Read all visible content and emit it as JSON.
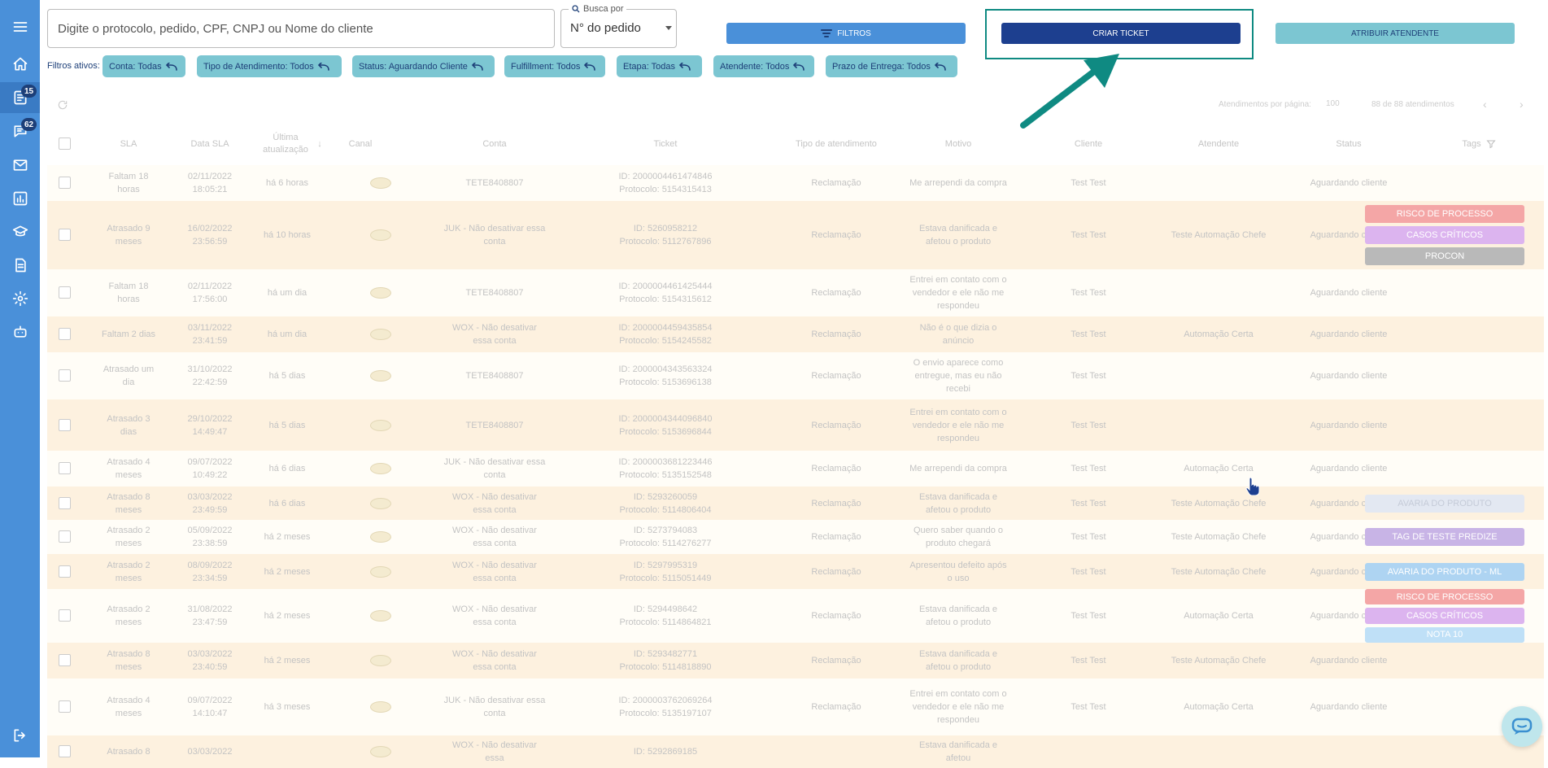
{
  "sidebar": {
    "items": [
      {
        "name": "menu-icon",
        "badge": ""
      },
      {
        "name": "home-icon",
        "badge": ""
      },
      {
        "name": "tickets-icon",
        "badge": "15"
      },
      {
        "name": "chat-icon",
        "badge": "62"
      },
      {
        "name": "mail-icon",
        "badge": ""
      },
      {
        "name": "reports-icon",
        "badge": ""
      },
      {
        "name": "training-icon",
        "badge": ""
      },
      {
        "name": "document-icon",
        "badge": ""
      },
      {
        "name": "settings-icon",
        "badge": ""
      },
      {
        "name": "bot-icon",
        "badge": ""
      },
      {
        "name": "logout-icon",
        "badge": ""
      }
    ]
  },
  "search": {
    "placeholder": "Digite o protocolo, pedido, CPF, CNPJ ou Nome do cliente",
    "busca_label": "Busca por",
    "busca_value": "N° do pedido"
  },
  "buttons": {
    "filtros": "FILTROS",
    "criar_ticket": "CRIAR TICKET",
    "atribuir_atendente": "ATRIBUIR ATENDENTE"
  },
  "filters": {
    "label": "Filtros ativos:",
    "chips": [
      "Conta: Todas",
      "Tipo de Atendimento: Todos",
      "Status:  Aguardando Cliente",
      "Fulfillment: Todos",
      "Etapa: Todas",
      "Atendente: Todos",
      "Prazo de Entrega: Todos"
    ]
  },
  "table": {
    "per_page_label": "Atendimentos por página:",
    "per_page_value": "100",
    "range_label": "88 de 88 atendimentos",
    "headers": {
      "sla": "SLA",
      "data_sla": "Data SLA",
      "ultima": "Última atualização",
      "canal": "Canal",
      "conta": "Conta",
      "ticket": "Ticket",
      "tipo": "Tipo de atendimento",
      "motivo": "Motivo",
      "cliente": "Cliente",
      "atendente": "Atendente",
      "status": "Status",
      "tags": "Tags"
    },
    "rows": [
      {
        "sla": "Faltam 18 horas",
        "data_sla": "02/11/2022 18:05:21",
        "ultima": "há 6 horas",
        "conta": "TETE8408807",
        "ticket_id": "ID: 2000004461474846",
        "protocolo": "Protocolo: 5154315413",
        "tipo": "Reclamação",
        "motivo": "Me arrependi da compra",
        "cliente": "Test Test",
        "atendente": "",
        "status": "Aguardando cliente",
        "tags": []
      },
      {
        "sla": "Atrasado 9 meses",
        "data_sla": "16/02/2022 23:56:59",
        "ultima": "há 10 horas",
        "conta": "JUK - Não desativar essa conta",
        "ticket_id": "ID: 5260958212",
        "protocolo": "Protocolo: 5112767896",
        "tipo": "Reclamação",
        "motivo": "Estava danificada e afetou o produto",
        "cliente": "Test Test",
        "atendente": "Teste Automação Chefe",
        "status": "Aguardando cliente",
        "tags": [
          {
            "label": "RISCO DE PROCESSO",
            "color": "#f4a6a6"
          },
          {
            "label": "CASOS CRÍTICOS",
            "color": "#dcb4ef"
          },
          {
            "label": "PROCON",
            "color": "#b9b9b9"
          }
        ]
      },
      {
        "sla": "Faltam 18 horas",
        "data_sla": "02/11/2022 17:56:00",
        "ultima": "há um dia",
        "conta": "TETE8408807",
        "ticket_id": "ID: 2000004461425444",
        "protocolo": "Protocolo: 5154315612",
        "tipo": "Reclamação",
        "motivo": "Entrei em contato com o vendedor e ele não me respondeu",
        "cliente": "Test Test",
        "atendente": "",
        "status": "Aguardando cliente",
        "tags": []
      },
      {
        "sla": "Faltam 2 dias",
        "data_sla": "03/11/2022 23:41:59",
        "ultima": "há um dia",
        "conta": "WOX - Não desativar essa conta",
        "ticket_id": "ID: 2000004459435854",
        "protocolo": "Protocolo: 5154245582",
        "tipo": "Reclamação",
        "motivo": "Não é o que dizia o anúncio",
        "cliente": "Test Test",
        "atendente": "Automação Certa",
        "status": "Aguardando cliente",
        "tags": []
      },
      {
        "sla": "Atrasado um dia",
        "data_sla": "31/10/2022 22:42:59",
        "ultima": "há 5 dias",
        "conta": "TETE8408807",
        "ticket_id": "ID: 2000004343563324",
        "protocolo": "Protocolo: 5153696138",
        "tipo": "Reclamação",
        "motivo": "O envio aparece como entregue, mas eu não recebi",
        "cliente": "Test Test",
        "atendente": "",
        "status": "Aguardando cliente",
        "tags": []
      },
      {
        "sla": "Atrasado 3 dias",
        "data_sla": "29/10/2022 14:49:47",
        "ultima": "há 5 dias",
        "conta": "TETE8408807",
        "ticket_id": "ID: 2000004344096840",
        "protocolo": "Protocolo: 5153696844",
        "tipo": "Reclamação",
        "motivo": "Entrei em contato com o vendedor e ele não me respondeu",
        "cliente": "Test Test",
        "atendente": "",
        "status": "Aguardando cliente",
        "tags": []
      },
      {
        "sla": "Atrasado 4 meses",
        "data_sla": "09/07/2022 10:49:22",
        "ultima": "há 6 dias",
        "conta": "JUK - Não desativar essa conta",
        "ticket_id": "ID: 2000003681223446",
        "protocolo": "Protocolo: 5135152548",
        "tipo": "Reclamação",
        "motivo": "Me arrependi da compra",
        "cliente": "Test Test",
        "atendente": "Automação Certa",
        "status": "Aguardando cliente",
        "tags": []
      },
      {
        "sla": "Atrasado 8 meses",
        "data_sla": "03/03/2022 23:49:59",
        "ultima": "há 6 dias",
        "conta": "WOX - Não desativar essa conta",
        "ticket_id": "ID: 5293260059",
        "protocolo": "Protocolo: 5114806404",
        "tipo": "Reclamação",
        "motivo": "Estava danificada e afetou o produto",
        "cliente": "Test Test",
        "atendente": "Teste Automação Chefe",
        "status": "Aguardando cliente",
        "tags": [
          {
            "label": "AVARIA DO PRODUTO",
            "color": "#e3e8f2"
          }
        ]
      },
      {
        "sla": "Atrasado 2 meses",
        "data_sla": "05/09/2022 23:38:59",
        "ultima": "há 2 meses",
        "conta": "WOX - Não desativar essa conta",
        "ticket_id": "ID: 5273794083",
        "protocolo": "Protocolo: 5114276277",
        "tipo": "Reclamação",
        "motivo": "Quero saber quando o produto chegará",
        "cliente": "Test Test",
        "atendente": "Teste Automação Chefe",
        "status": "Aguardando cliente",
        "tags": [
          {
            "label": "TAG DE TESTE PREDIZE",
            "color": "#c8b4e6"
          }
        ]
      },
      {
        "sla": "Atrasado 2 meses",
        "data_sla": "08/09/2022 23:34:59",
        "ultima": "há 2 meses",
        "conta": "WOX - Não desativar essa conta",
        "ticket_id": "ID: 5297995319",
        "protocolo": "Protocolo: 5115051449",
        "tipo": "Reclamação",
        "motivo": "Apresentou defeito após o uso",
        "cliente": "Test Test",
        "atendente": "Teste Automação Chefe",
        "status": "Aguardando cliente",
        "tags": [
          {
            "label": "AVARIA DO PRODUTO - ML",
            "color": "#aed4f2"
          }
        ]
      },
      {
        "sla": "Atrasado 2 meses",
        "data_sla": "31/08/2022 23:47:59",
        "ultima": "há 2 meses",
        "conta": "WOX - Não desativar essa conta",
        "ticket_id": "ID: 5294498642",
        "protocolo": "Protocolo: 5114864821",
        "tipo": "Reclamação",
        "motivo": "Estava danificada e afetou o produto",
        "cliente": "Test Test",
        "atendente": "Automação Certa",
        "status": "Aguardando cliente",
        "tags": [
          {
            "label": "RISCO DE PROCESSO",
            "color": "#f4a6a6"
          },
          {
            "label": "CASOS CRÍTICOS",
            "color": "#dcb4ef"
          },
          {
            "label": "NOTA 10",
            "color": "#bfe0f7"
          }
        ]
      },
      {
        "sla": "Atrasado 8 meses",
        "data_sla": "03/03/2022 23:40:59",
        "ultima": "há 2 meses",
        "conta": "WOX - Não desativar essa conta",
        "ticket_id": "ID: 5293482771",
        "protocolo": "Protocolo: 5114818890",
        "tipo": "Reclamação",
        "motivo": "Estava danificada e afetou o produto",
        "cliente": "Test Test",
        "atendente": "Teste Automação Chefe",
        "status": "Aguardando cliente",
        "tags": []
      },
      {
        "sla": "Atrasado 4 meses",
        "data_sla": "09/07/2022 14:10:47",
        "ultima": "há 3 meses",
        "conta": "JUK - Não desativar essa conta",
        "ticket_id": "ID: 2000003762069264",
        "protocolo": "Protocolo: 5135197107",
        "tipo": "Reclamação",
        "motivo": "Entrei em contato com o vendedor e ele não me respondeu",
        "cliente": "Test Test",
        "atendente": "Automação Certa",
        "status": "Aguardando cliente",
        "tags": []
      },
      {
        "sla": "Atrasado 8",
        "data_sla": "03/03/2022",
        "ultima": "",
        "conta": "WOX - Não desativar essa",
        "ticket_id": "ID: 5292869185",
        "protocolo": "",
        "tipo": "",
        "motivo": "Estava danificada e afetou",
        "cliente": "",
        "atendente": "",
        "status": "",
        "tags": []
      }
    ]
  }
}
